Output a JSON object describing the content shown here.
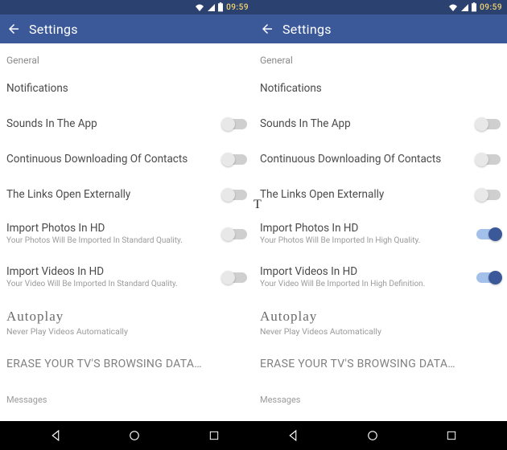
{
  "status": {
    "time": "09:59"
  },
  "appbar": {
    "title": "Settings",
    "back_label": "Back"
  },
  "sections": {
    "general": "General"
  },
  "rows": {
    "notifications": "Notifications",
    "sounds": "Sounds In The App",
    "contacts": "Continuous Downloading Of Contacts",
    "links": "The Links Open Externally",
    "photos": {
      "label": "Import Photos In HD",
      "sub_std": "Your Photos Will Be Imported In Standard Quality.",
      "sub_high": "Your Photos Will Be Imported In High Quality."
    },
    "videos": {
      "label": "Import Videos In HD",
      "sub_std": "Your Video Will Be Imported In Standard Quality.",
      "sub_high": "Your Video Will Be Imported In High Definition."
    },
    "autoplay": {
      "label": "Autoplay",
      "sub": "Never Play Videos Automatically"
    },
    "erase": "ERASE YOUR TV'S BROWSING DATA…",
    "messages": "Messages"
  },
  "overlay": {
    "t": "T"
  }
}
